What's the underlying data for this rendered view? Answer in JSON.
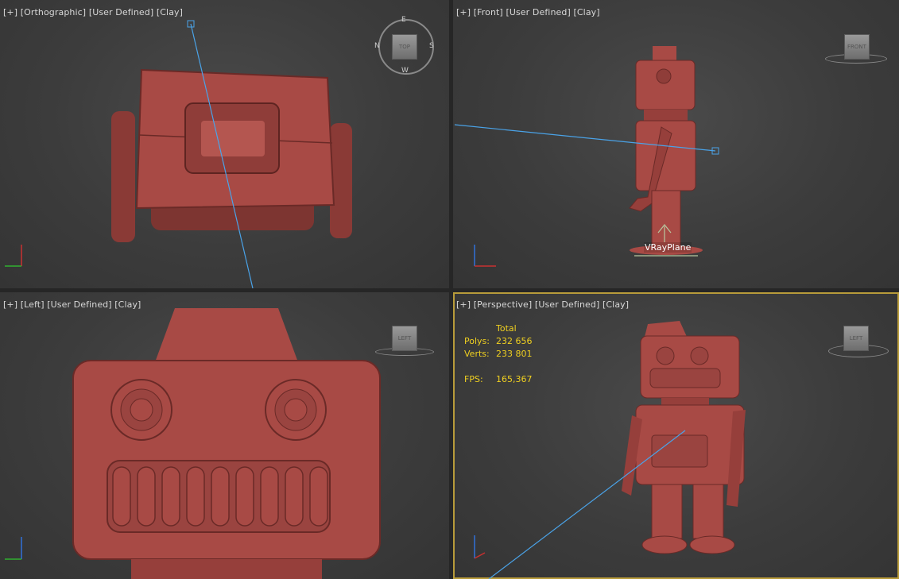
{
  "viewports": {
    "top_left": {
      "labels": [
        "[+]",
        "[Orthographic]",
        "[User Defined]",
        "[Clay]"
      ],
      "compass": {
        "cube_label": "TOP",
        "n": "N",
        "e": "E",
        "s": "S",
        "w": "W"
      }
    },
    "top_right": {
      "labels": [
        "[+]",
        "[Front]",
        "[User Defined]",
        "[Clay]"
      ],
      "cube_label": "FRONT",
      "object_label": "VRayPlane"
    },
    "bottom_left": {
      "labels": [
        "[+]",
        "[Left]",
        "[User Defined]",
        "[Clay]"
      ],
      "cube_label": "LEFT"
    },
    "bottom_right": {
      "labels": [
        "[+]",
        "[Perspective]",
        "[User Defined]",
        "[Clay]"
      ],
      "cube_label": "LEFT",
      "stats": {
        "header": "Total",
        "polys_label": "Polys:",
        "polys": "232 656",
        "verts_label": "Verts:",
        "verts": "233 801",
        "fps_label": "FPS:",
        "fps": "165,367"
      }
    }
  },
  "colors": {
    "clay": "#a84a45",
    "active_border": "#b89b3a",
    "stats_text": "#f0d020",
    "line": "#4aa3e8"
  }
}
